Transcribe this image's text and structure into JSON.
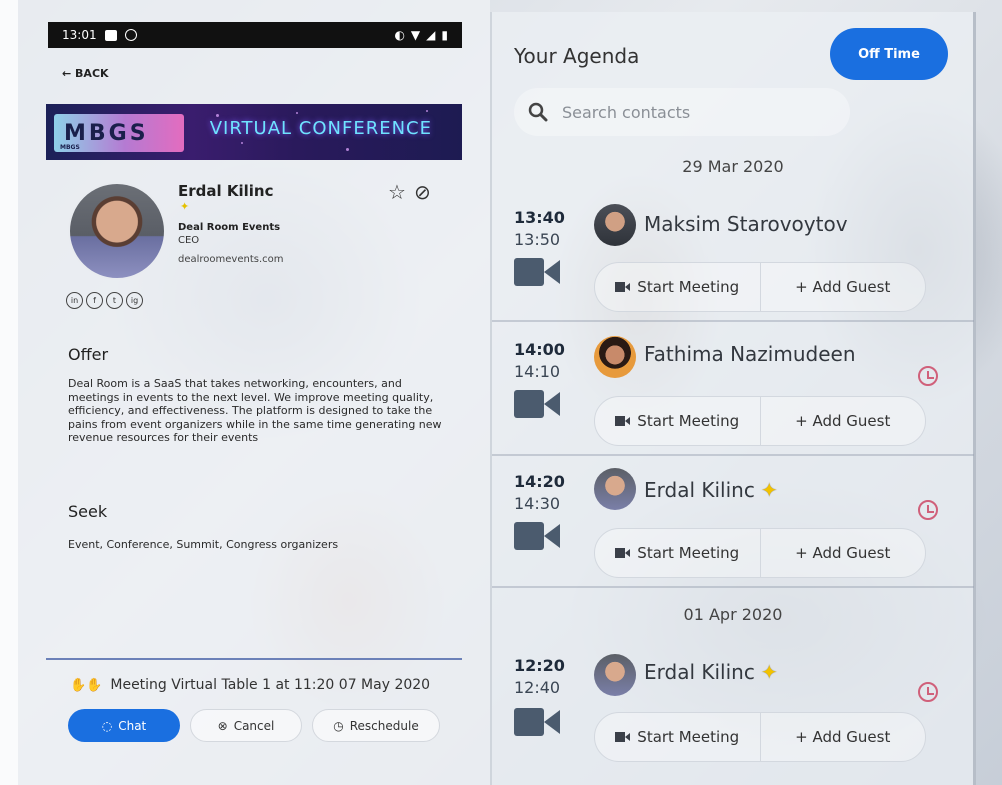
{
  "status_bar": {
    "time": "13:01"
  },
  "nav": {
    "back_label": "← BACK"
  },
  "banner": {
    "logo_text": "MBGS",
    "logo_subtext": "MBGS",
    "title": "VIRTUAL CONFERENCE"
  },
  "profile": {
    "name": "Erdal Kilinc",
    "company": "Deal Room Events",
    "role": "CEO",
    "website": "dealroomevents.com",
    "socials": [
      "in",
      "f",
      "t",
      "ig"
    ]
  },
  "offer": {
    "heading": "Offer",
    "text": "Deal Room is a SaaS that takes networking, encounters, and meetings in events to the next level. We improve meeting quality, efficiency, and effectiveness. The platform is designed to take the pains from event organizers while in the same time generating new revenue resources for their events"
  },
  "seek": {
    "heading": "Seek",
    "text": "Event, Conference, Summit, Congress organizers"
  },
  "meeting": {
    "info": "Meeting Virtual Table 1 at 11:20 07 May 2020",
    "chat_label": "Chat",
    "cancel_label": "Cancel",
    "reschedule_label": "Reschedule"
  },
  "agenda": {
    "title": "Your Agenda",
    "off_time_label": "Off Time",
    "search_placeholder": "Search contacts",
    "days": [
      {
        "date": "29 Mar 2020",
        "slots": [
          {
            "start": "13:40",
            "end": "13:50",
            "name": "Maksim Starovoytov",
            "star": false,
            "clock": false
          },
          {
            "start": "14:00",
            "end": "14:10",
            "name": "Fathima Nazimudeen",
            "star": false,
            "clock": true
          },
          {
            "start": "14:20",
            "end": "14:30",
            "name": "Erdal Kilinc",
            "star": true,
            "clock": true
          }
        ]
      },
      {
        "date": "01 Apr 2020",
        "slots": [
          {
            "start": "12:20",
            "end": "12:40",
            "name": "Erdal Kilinc",
            "star": true,
            "clock": true
          }
        ]
      }
    ],
    "start_meeting_label": "Start Meeting",
    "add_guest_label": "+ Add Guest"
  },
  "colors": {
    "primary": "#1a6fe0",
    "clock_accent": "#d0607a"
  }
}
